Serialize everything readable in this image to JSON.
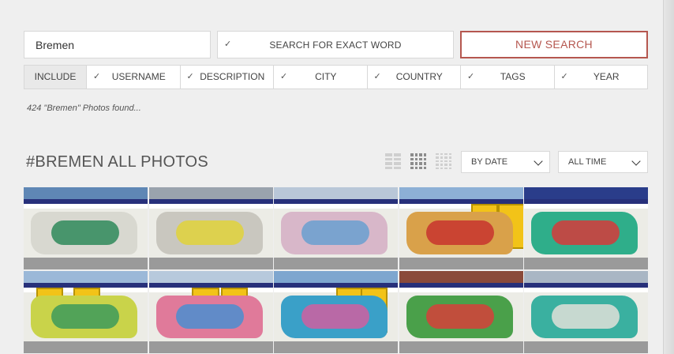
{
  "search": {
    "value": "Bremen"
  },
  "exact_word": {
    "check": "✓",
    "label": "SEARCH FOR EXACT WORD"
  },
  "new_search": {
    "label": "NEW SEARCH"
  },
  "filters": {
    "include_label": "INCLUDE",
    "items": [
      {
        "check": "✓",
        "label": "USERNAME"
      },
      {
        "check": "✓",
        "label": "DESCRIPTION"
      },
      {
        "check": "✓",
        "label": "CITY"
      },
      {
        "check": "✓",
        "label": "COUNTRY"
      },
      {
        "check": "✓",
        "label": "TAGS"
      },
      {
        "check": "✓",
        "label": "YEAR"
      }
    ]
  },
  "results_text": "424 \"Bremen\" Photos found...",
  "heading": "#BREMEN ALL PHOTOS",
  "view_icons": [
    "list-view-icon",
    "grid-view-icon",
    "small-grid-view-icon"
  ],
  "sort": {
    "selected": "BY DATE"
  },
  "timeframe": {
    "selected": "ALL TIME"
  },
  "colors": {
    "accent": "#b5574f",
    "train_blue": "#27307a",
    "door_yellow": "#f2c318"
  },
  "photos": [
    {
      "sky": "#5f87b5",
      "piece": "#d8d8d0",
      "piece2": "#2f8a5a"
    },
    {
      "sky": "#9aa3ad",
      "piece": "#c9c7bf",
      "piece2": "#e0d23a"
    },
    {
      "sky": "#b9c7d8",
      "piece": "#d8b7c9",
      "piece2": "#6aa0d0"
    },
    {
      "sky": "#8db0d6",
      "piece": "#d9a14a",
      "piece2": "#c7342e"
    },
    {
      "sky": "#2a3d8a",
      "piece": "#2fae8a",
      "piece2": "#d63a3a"
    },
    {
      "sky": "#9bb8d8",
      "piece": "#c9d34a",
      "piece2": "#3d9a5a"
    },
    {
      "sky": "#b7c9dc",
      "piece": "#e07a9a",
      "piece2": "#4a8ed0"
    },
    {
      "sky": "#7ea6cf",
      "piece": "#3aa0c8",
      "piece2": "#d05fa0"
    },
    {
      "sky": "#8a4a3a",
      "piece": "#4aa04a",
      "piece2": "#d6403a"
    },
    {
      "sky": "#a9b6c4",
      "piece": "#3ab0a0",
      "piece2": "#e0e0d8"
    }
  ]
}
